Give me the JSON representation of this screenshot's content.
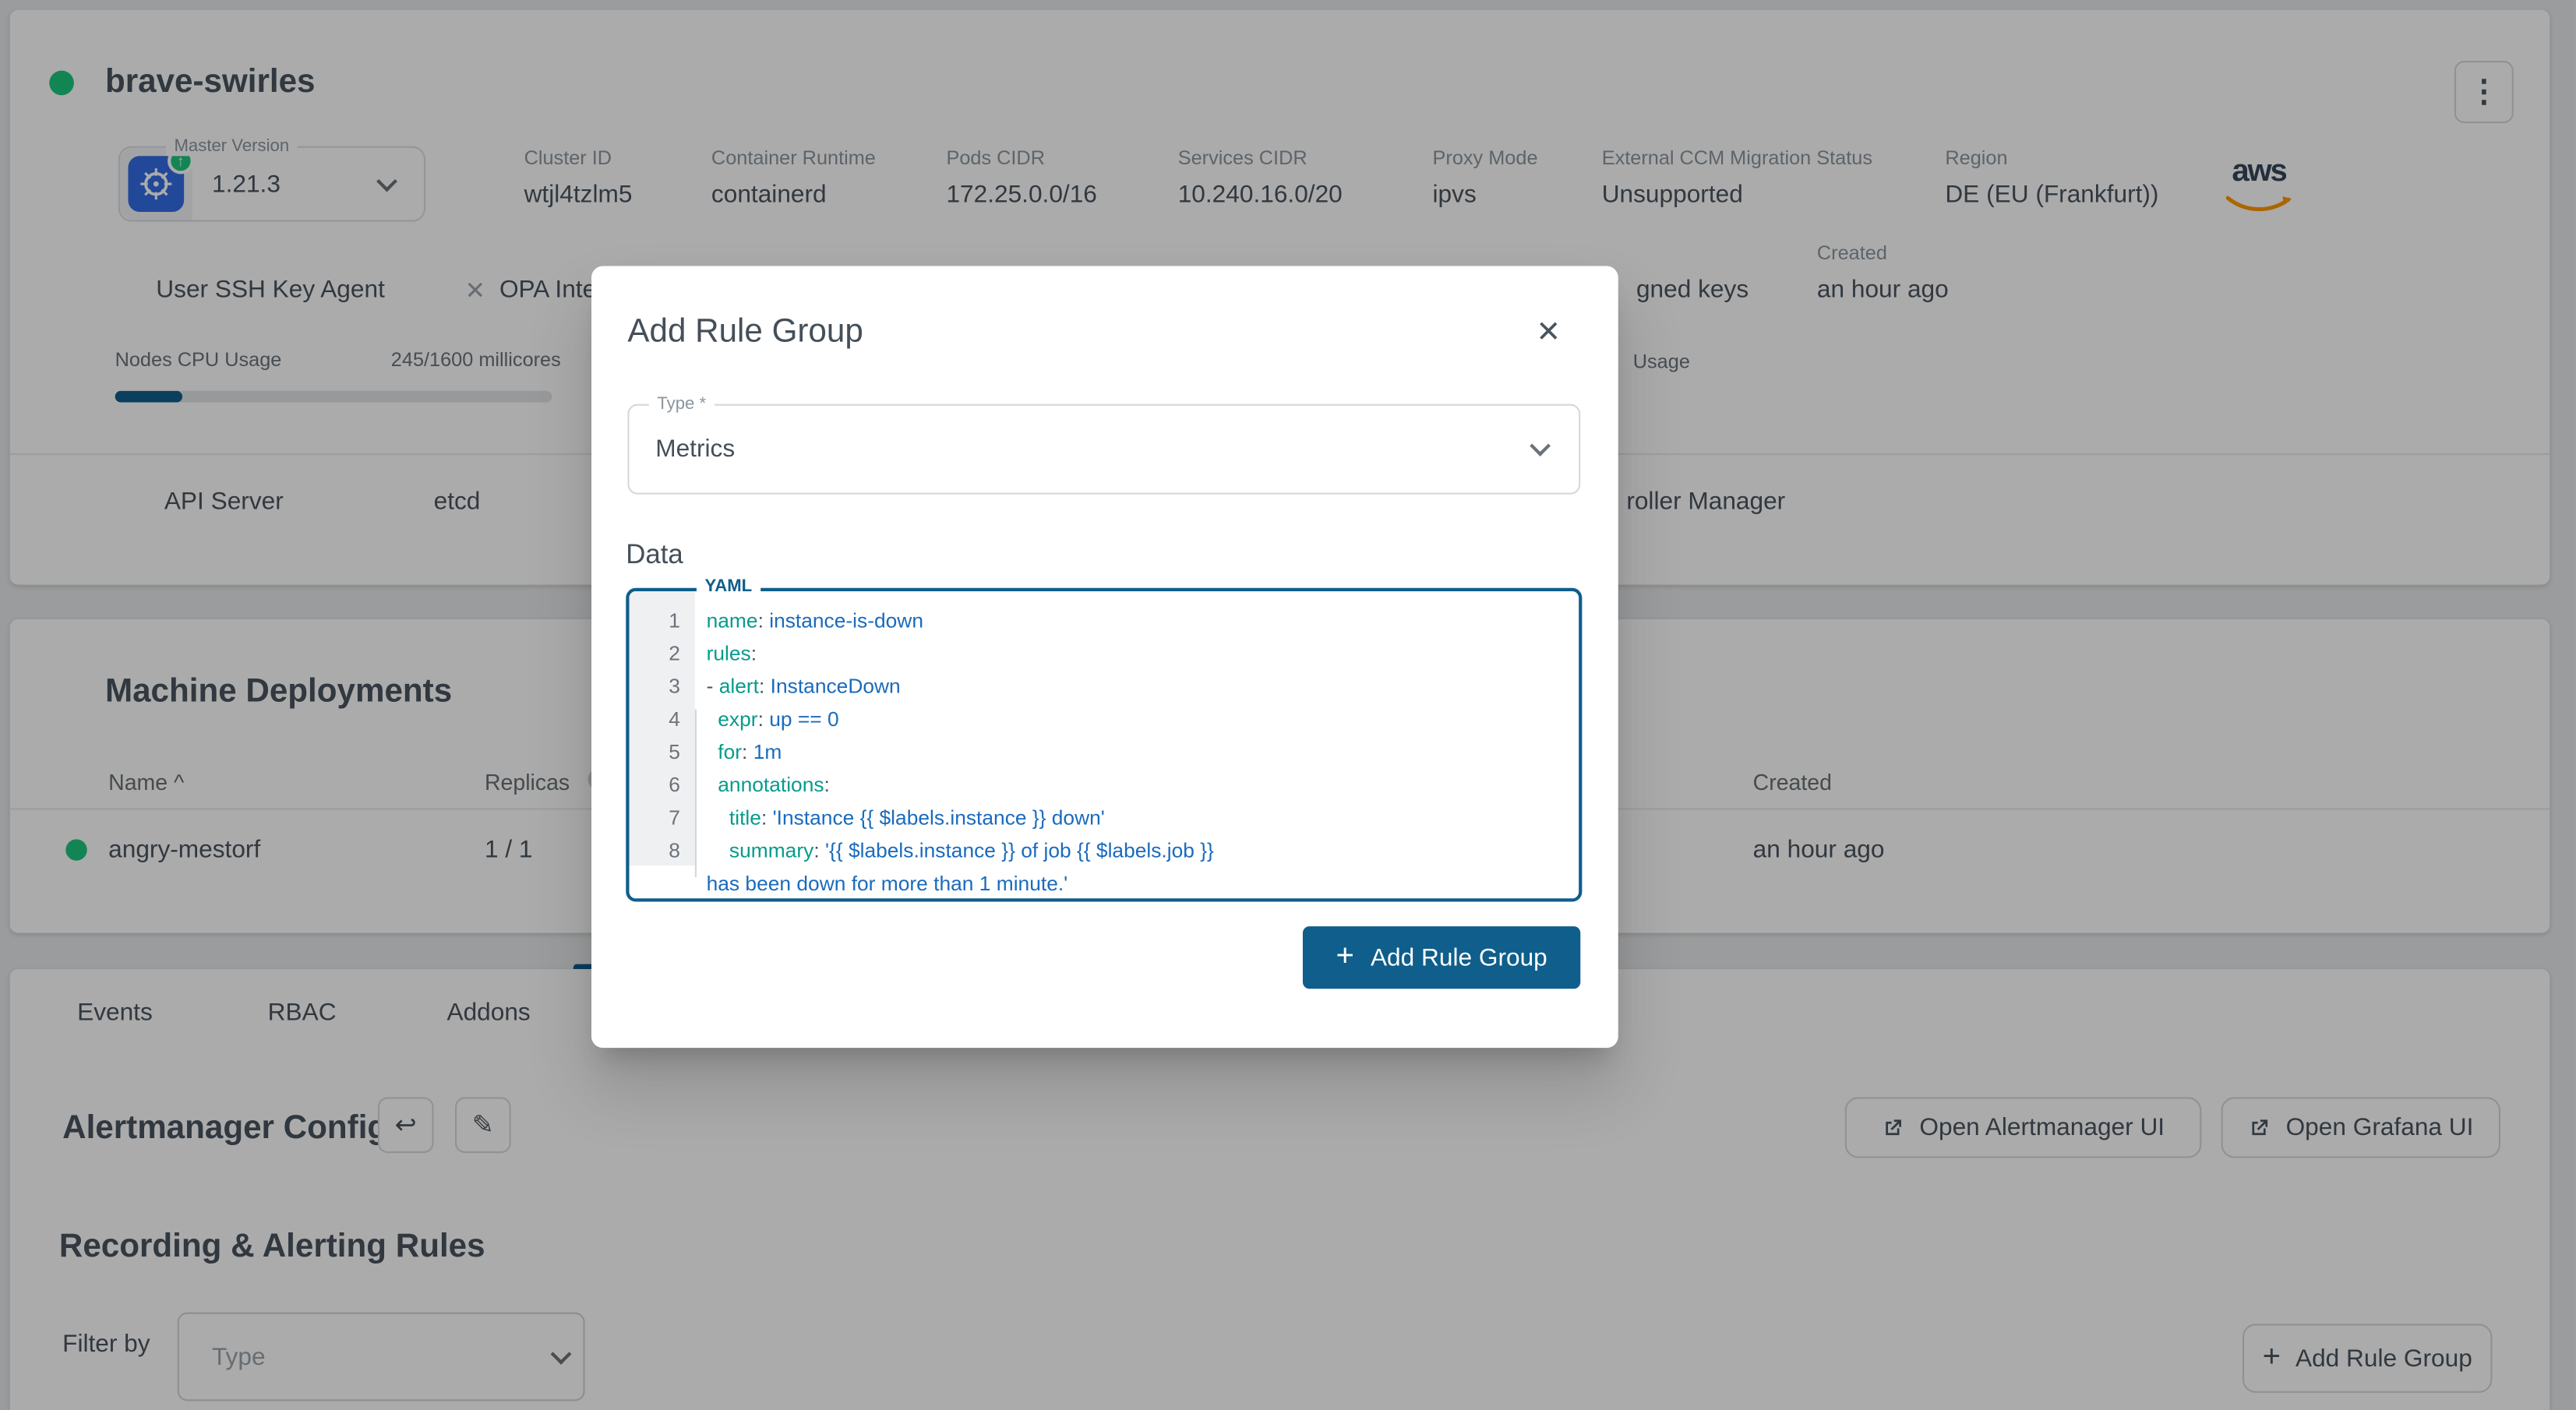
{
  "colors": {
    "accent": "#0f5e8b",
    "key": "#089b8c",
    "val": "#1a6bbd",
    "green": "#1dc67f",
    "k8s": "#326ce5",
    "aws-orange": "#ff9900"
  },
  "cluster": {
    "name": "brave-swirles",
    "kebab": "⋮",
    "master_version_label": "Master Version",
    "master_version": "1.21.3",
    "info": [
      {
        "label": "Cluster ID",
        "value": "wtjl4tzlm5",
        "x": 313
      },
      {
        "label": "Container Runtime",
        "value": "containerd",
        "x": 427
      },
      {
        "label": "Pods CIDR",
        "value": "172.25.0.0/16",
        "x": 570
      },
      {
        "label": "Services CIDR",
        "value": "10.240.16.0/20",
        "x": 711
      },
      {
        "label": "Proxy Mode",
        "value": "ipvs",
        "x": 866
      },
      {
        "label": "External CCM Migration Status",
        "value": "Unsupported",
        "x": 969
      },
      {
        "label": "Region",
        "value": "DE (EU (Frankfurt))",
        "x": 1178
      }
    ],
    "provider": "aws",
    "created_label": "Created",
    "created_value": "an hour ago",
    "ssh_agent_label": "User SSH Key Agent",
    "ssh_status_icon": "✕",
    "opa_fragment": "OPA Inte",
    "keys_fragment": "gned keys",
    "cpu_usage_label": "Nodes CPU Usage",
    "cpu_usage_value": "245/1600 millicores",
    "cpu_usage_percent": 15.3,
    "memory_usage_fragment": "Usage",
    "control_plane_1": "API Server",
    "control_plane_2": "etcd",
    "control_plane_fragment": "roller Manager"
  },
  "chart_data": {
    "type": "bar",
    "title": "Nodes CPU Usage",
    "categories": [
      "CPU millicores used"
    ],
    "values": [
      245
    ],
    "xlim": [
      0,
      1600
    ],
    "unit": "millicores"
  },
  "machine_deployments": {
    "title": "Machine Deployments",
    "col_name": "Name ^",
    "col_replicas": "Replicas",
    "col_created": "Created",
    "rows": [
      {
        "name": "angry-mestorf",
        "replicas": "1 / 1",
        "created": "an hour ago"
      }
    ]
  },
  "tabs": [
    {
      "label": "Events",
      "x": 41
    },
    {
      "label": "RBAC",
      "x": 157
    },
    {
      "label": "Addons",
      "x": 266
    }
  ],
  "alertmanager": {
    "title": "Alertmanager Config",
    "undo_icon": "↩",
    "edit_icon": "✎",
    "open_alertmanager": "Open Alertmanager UI",
    "open_grafana": "Open Grafana UI"
  },
  "rules": {
    "title": "Recording & Alerting Rules",
    "filter_label": "Filter by",
    "filter_placeholder": "Type",
    "add_button": "Add Rule Group",
    "plus": "+"
  },
  "modal": {
    "title": "Add Rule Group",
    "close_icon": "✕",
    "type_label": "Type *",
    "type_value": "Metrics",
    "data_label": "Data",
    "editor_label": "YAML",
    "code_lines": [
      {
        "num": "1",
        "tokens": [
          [
            "key",
            "name"
          ],
          [
            "plain",
            ":"
          ],
          [
            "value",
            " instance-is-down"
          ]
        ]
      },
      {
        "num": "2",
        "tokens": [
          [
            "key",
            "rules"
          ],
          [
            "plain",
            ":"
          ]
        ]
      },
      {
        "num": "3",
        "tokens": [
          [
            "plain",
            "- "
          ],
          [
            "key",
            "alert"
          ],
          [
            "plain",
            ":"
          ],
          [
            "value",
            " InstanceDown"
          ]
        ]
      },
      {
        "num": "4",
        "tokens": [
          [
            "plain",
            "  "
          ],
          [
            "key",
            "expr"
          ],
          [
            "plain",
            ":"
          ],
          [
            "value",
            " up == 0"
          ]
        ]
      },
      {
        "num": "5",
        "tokens": [
          [
            "plain",
            "  "
          ],
          [
            "key",
            "for"
          ],
          [
            "plain",
            ":"
          ],
          [
            "value",
            " 1m"
          ]
        ]
      },
      {
        "num": "6",
        "tokens": [
          [
            "plain",
            "  "
          ],
          [
            "key",
            "annotations"
          ],
          [
            "plain",
            ":"
          ]
        ]
      },
      {
        "num": "7",
        "tokens": [
          [
            "plain",
            "    "
          ],
          [
            "key",
            "title"
          ],
          [
            "plain",
            ":"
          ],
          [
            "value",
            " 'Instance {{ $labels.instance }} down'"
          ]
        ]
      },
      {
        "num": "8",
        "tokens": [
          [
            "plain",
            "    "
          ],
          [
            "key",
            "summary"
          ],
          [
            "plain",
            ":"
          ],
          [
            "value",
            " '{{ $labels.instance }} of job {{ $labels.job }}"
          ]
        ]
      },
      {
        "num": "",
        "tokens": [
          [
            "value",
            "has been down for more than 1 minute.'"
          ]
        ]
      }
    ],
    "submit": "Add Rule Group",
    "plus": "+"
  }
}
